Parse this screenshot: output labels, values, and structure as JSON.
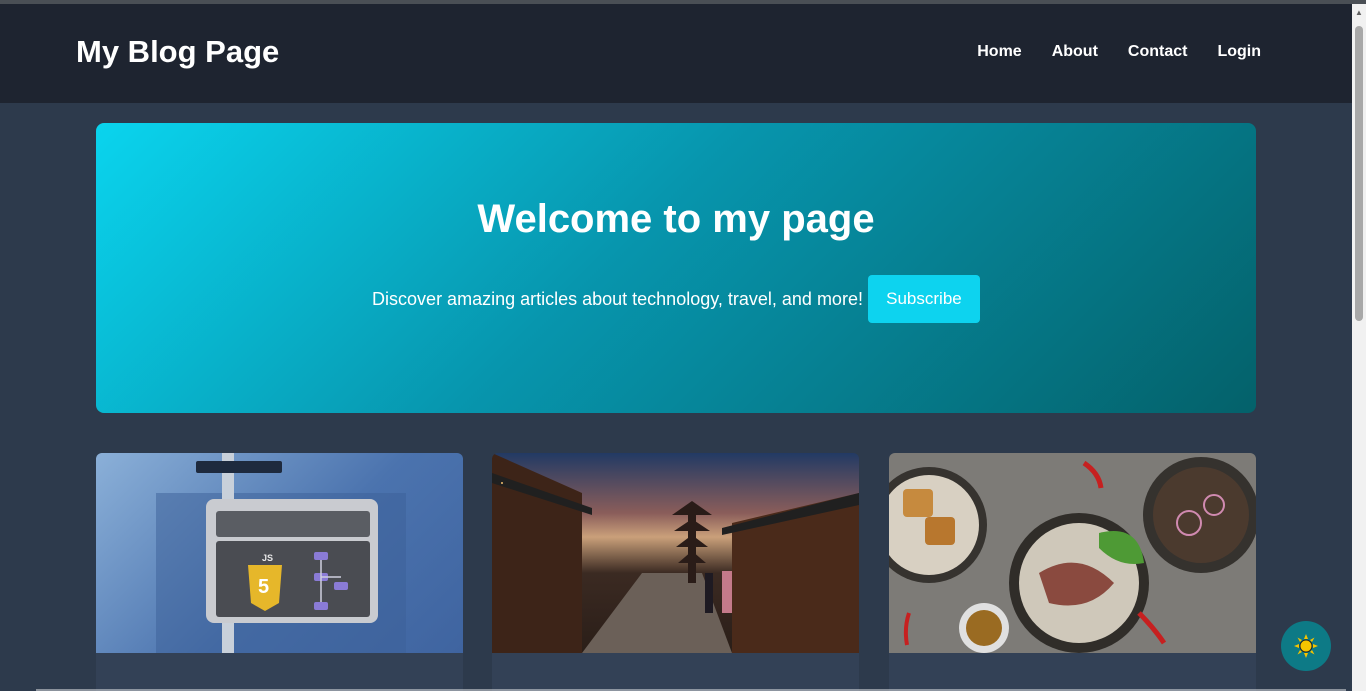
{
  "header": {
    "brand": "My Blog Page",
    "nav": [
      "Home",
      "About",
      "Contact",
      "Login"
    ]
  },
  "hero": {
    "title": "Welcome to my page",
    "subtitle": "Discover amazing articles about technology, travel, and more!",
    "subscribe_label": "Subscribe"
  },
  "cards": [
    {
      "image": "javascript-illustration"
    },
    {
      "image": "kyoto-street-pagoda"
    },
    {
      "image": "food-bowls"
    }
  ],
  "theme_toggle": {
    "icon": "sun-icon"
  },
  "colors": {
    "header_bg": "#1e2430",
    "page_bg": "#2d3a4c",
    "accent": "#0dd3ef",
    "hero_gradient_start": "#0ad4ee",
    "hero_gradient_end": "#04616a",
    "toggle_bg": "#0d7a86",
    "sun": "#f5c400"
  }
}
